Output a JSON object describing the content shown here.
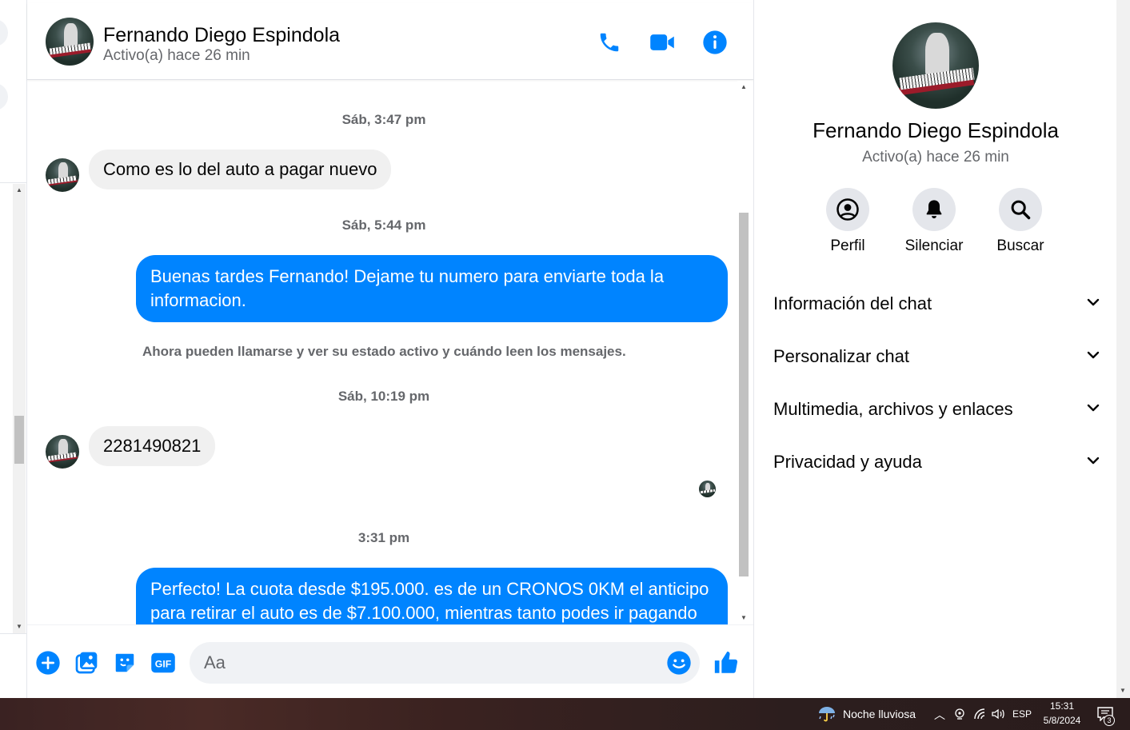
{
  "header": {
    "name": "Fernando Diego Espindola",
    "status": "Activo(a) hace 26 min",
    "icons": [
      "phone-icon",
      "video-icon",
      "info-icon"
    ]
  },
  "colors": {
    "accent": "#0084ff",
    "incoming_bubble": "#f0f0f0",
    "muted_text": "#65676b"
  },
  "messages": {
    "ts1": "Sáb, 3:47 pm",
    "m1": "Como es lo del auto a pagar nuevo",
    "ts2": "Sáb, 5:44 pm",
    "m2": "Buenas tardes Fernando! Dejame tu numero para enviarte toda la informacion.",
    "system": "Ahora pueden llamarse y ver su estado activo y cuándo leen los mensajes.",
    "ts3": "Sáb, 10:19 pm",
    "m3": "2281490821",
    "ts4": "3:31 pm",
    "m4": "Perfecto! La cuota desde $195.000. es de un CRONOS 0KM el anticipo para retirar el auto es de $7.100.000, mientras tanto podes ir pagando"
  },
  "composer": {
    "placeholder": "Aa",
    "icons": [
      "plus-icon",
      "image-icon",
      "sticker-icon",
      "gif-icon",
      "emoji-icon",
      "like-icon"
    ]
  },
  "info": {
    "name": "Fernando Diego Espindola",
    "status": "Activo(a) hace 26 min",
    "actions": [
      {
        "label": "Perfil",
        "icon": "profile-icon"
      },
      {
        "label": "Silenciar",
        "icon": "bell-icon"
      },
      {
        "label": "Buscar",
        "icon": "search-icon"
      }
    ],
    "sections": [
      "Información del chat",
      "Personalizar chat",
      "Multimedia, archivos y enlaces",
      "Privacidad y ayuda"
    ]
  },
  "taskbar": {
    "weather": "Noche lluviosa",
    "language": "ESP",
    "time": "15:31",
    "date": "5/8/2024",
    "notifications": "3"
  }
}
